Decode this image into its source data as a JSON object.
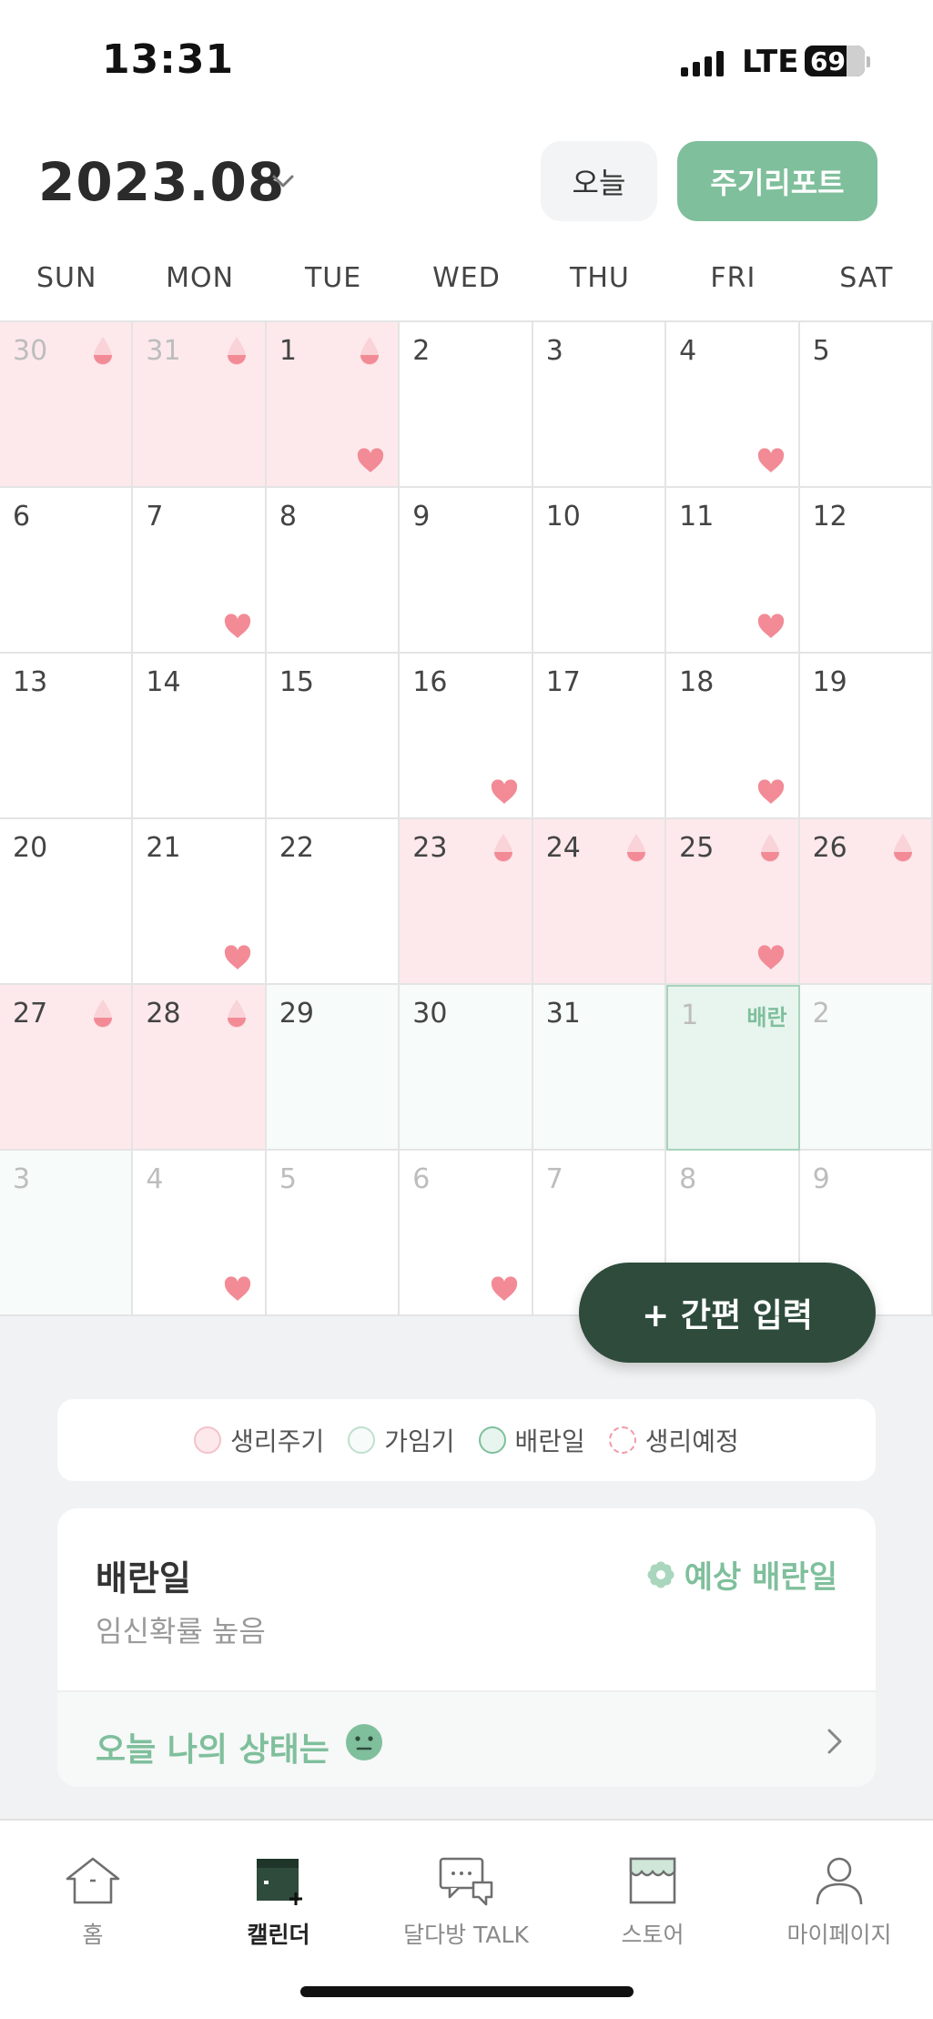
{
  "status_bar": {
    "time": "13:31",
    "network": "LTE",
    "battery": "69"
  },
  "header": {
    "month": "2023.08",
    "today_label": "오늘",
    "report_label": "주기리포트"
  },
  "weekdays": [
    "SUN",
    "MON",
    "TUE",
    "WED",
    "THU",
    "FRI",
    "SAT"
  ],
  "calendar": {
    "weeks": [
      [
        {
          "day": "30",
          "other": true,
          "type": "period",
          "drop": true,
          "heart": false
        },
        {
          "day": "31",
          "other": true,
          "type": "period",
          "drop": true,
          "heart": false
        },
        {
          "day": "1",
          "other": false,
          "type": "period",
          "drop": true,
          "heart": true
        },
        {
          "day": "2",
          "other": false,
          "type": "",
          "drop": false,
          "heart": false
        },
        {
          "day": "3",
          "other": false,
          "type": "",
          "drop": false,
          "heart": false
        },
        {
          "day": "4",
          "other": false,
          "type": "",
          "drop": false,
          "heart": true
        },
        {
          "day": "5",
          "other": false,
          "type": "",
          "drop": false,
          "heart": false
        }
      ],
      [
        {
          "day": "6",
          "other": false,
          "type": "",
          "drop": false,
          "heart": false
        },
        {
          "day": "7",
          "other": false,
          "type": "",
          "drop": false,
          "heart": true
        },
        {
          "day": "8",
          "other": false,
          "type": "",
          "drop": false,
          "heart": false
        },
        {
          "day": "9",
          "other": false,
          "type": "",
          "drop": false,
          "heart": false
        },
        {
          "day": "10",
          "other": false,
          "type": "",
          "drop": false,
          "heart": false
        },
        {
          "day": "11",
          "other": false,
          "type": "",
          "drop": false,
          "heart": true
        },
        {
          "day": "12",
          "other": false,
          "type": "",
          "drop": false,
          "heart": false
        }
      ],
      [
        {
          "day": "13",
          "other": false,
          "type": "",
          "drop": false,
          "heart": false
        },
        {
          "day": "14",
          "other": false,
          "type": "",
          "drop": false,
          "heart": false
        },
        {
          "day": "15",
          "other": false,
          "type": "",
          "drop": false,
          "heart": false
        },
        {
          "day": "16",
          "other": false,
          "type": "",
          "drop": false,
          "heart": true
        },
        {
          "day": "17",
          "other": false,
          "type": "",
          "drop": false,
          "heart": false
        },
        {
          "day": "18",
          "other": false,
          "type": "",
          "drop": false,
          "heart": true
        },
        {
          "day": "19",
          "other": false,
          "type": "",
          "drop": false,
          "heart": false
        }
      ],
      [
        {
          "day": "20",
          "other": false,
          "type": "",
          "drop": false,
          "heart": false
        },
        {
          "day": "21",
          "other": false,
          "type": "",
          "drop": false,
          "heart": true
        },
        {
          "day": "22",
          "other": false,
          "type": "",
          "drop": false,
          "heart": false
        },
        {
          "day": "23",
          "other": false,
          "type": "period",
          "drop": true,
          "heart": false
        },
        {
          "day": "24",
          "other": false,
          "type": "period",
          "drop": true,
          "heart": false
        },
        {
          "day": "25",
          "other": false,
          "type": "period",
          "drop": true,
          "heart": true
        },
        {
          "day": "26",
          "other": false,
          "type": "period",
          "drop": true,
          "heart": false
        }
      ],
      [
        {
          "day": "27",
          "other": false,
          "type": "period",
          "drop": true,
          "heart": false
        },
        {
          "day": "28",
          "other": false,
          "type": "period",
          "drop": true,
          "heart": false
        },
        {
          "day": "29",
          "other": false,
          "type": "fertile",
          "drop": false,
          "heart": false
        },
        {
          "day": "30",
          "other": false,
          "type": "fertile",
          "drop": false,
          "heart": false
        },
        {
          "day": "31",
          "other": false,
          "type": "fertile",
          "drop": false,
          "heart": false
        },
        {
          "day": "1",
          "other": true,
          "type": "ovul",
          "drop": false,
          "heart": false,
          "label": "배란"
        },
        {
          "day": "2",
          "other": true,
          "type": "fertile",
          "drop": false,
          "heart": false
        }
      ],
      [
        {
          "day": "3",
          "other": true,
          "type": "fertile",
          "drop": false,
          "heart": false
        },
        {
          "day": "4",
          "other": true,
          "type": "",
          "drop": false,
          "heart": true
        },
        {
          "day": "5",
          "other": true,
          "type": "",
          "drop": false,
          "heart": false
        },
        {
          "day": "6",
          "other": true,
          "type": "",
          "drop": false,
          "heart": true
        },
        {
          "day": "7",
          "other": true,
          "type": "",
          "drop": false,
          "heart": false
        },
        {
          "day": "8",
          "other": true,
          "type": "",
          "drop": false,
          "heart": false
        },
        {
          "day": "9",
          "other": true,
          "type": "",
          "drop": false,
          "heart": false
        }
      ]
    ]
  },
  "quick_input": {
    "label": "+ 간편 입력"
  },
  "legend": [
    {
      "label": "생리주기",
      "fill": "#fde9ec",
      "border": "#f3c2ca",
      "dashed": false
    },
    {
      "label": "가임기",
      "fill": "#f7fbf9",
      "border": "#bfe0cd",
      "dashed": false
    },
    {
      "label": "배란일",
      "fill": "#e7f5ee",
      "border": "#7fbf9c",
      "dashed": false
    },
    {
      "label": "생리예정",
      "fill": "#ffffff",
      "border": "#f29aa6",
      "dashed": true
    }
  ],
  "info_card": {
    "title": "배란일",
    "subtitle": "임신확률 높음",
    "tag": "예상 배란일",
    "status_prompt": "오늘 나의 상태는"
  },
  "nav": [
    {
      "label": "홈",
      "icon": "home-icon",
      "active": false
    },
    {
      "label": "캘린더",
      "icon": "calendar-icon",
      "active": true
    },
    {
      "label": "달다방 TALK",
      "icon": "chat-icon",
      "active": false
    },
    {
      "label": "스토어",
      "icon": "store-icon",
      "active": false
    },
    {
      "label": "마이페이지",
      "icon": "person-icon",
      "active": false
    }
  ],
  "colors": {
    "accent": "#7fbf9c",
    "dark_green": "#2e4b3c",
    "period_bg": "#fde9ec",
    "fertile_bg": "#f7fbf9",
    "ovulation_bg": "#e7f5ee",
    "heart": "#f28b96"
  }
}
